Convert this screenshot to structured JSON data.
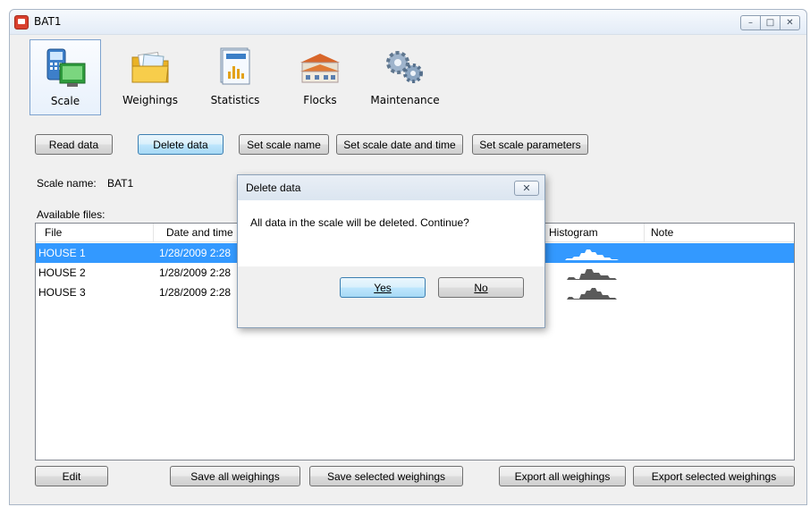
{
  "window": {
    "title": "BAT1"
  },
  "toolbar": {
    "items": [
      {
        "label": "Scale",
        "icon": "scale-icon",
        "selected": true
      },
      {
        "label": "Weighings",
        "icon": "folder-icon",
        "selected": false
      },
      {
        "label": "Statistics",
        "icon": "statistics-icon",
        "selected": false
      },
      {
        "label": "Flocks",
        "icon": "flocks-icon",
        "selected": false
      },
      {
        "label": "Maintenance",
        "icon": "gears-icon",
        "selected": false
      }
    ]
  },
  "actions": {
    "read": "Read data",
    "delete": "Delete data",
    "set_name": "Set scale name",
    "set_datetime": "Set scale date and time",
    "set_params": "Set scale parameters"
  },
  "scale_name_label": "Scale name:",
  "scale_name_value": "BAT1",
  "available_files_label": "Available files:",
  "files": {
    "columns": [
      "File",
      "Date and time",
      "Histogram",
      "Note"
    ],
    "rows": [
      {
        "file": "HOUSE 1",
        "datetime": "1/28/2009 2:28",
        "selected": true
      },
      {
        "file": "HOUSE 2",
        "datetime": "1/28/2009 2:28",
        "selected": false
      },
      {
        "file": "HOUSE 3",
        "datetime": "1/28/2009 2:28",
        "selected": false
      }
    ]
  },
  "bottom_buttons": {
    "edit": "Edit",
    "save_all": "Save all weighings",
    "save_selected": "Save selected weighings",
    "export_all": "Export all weighings",
    "export_selected": "Export selected weighings"
  },
  "dialog": {
    "title": "Delete data",
    "message": "All data in the scale will be deleted. Continue?",
    "yes": "Yes",
    "no": "No"
  },
  "colors": {
    "selection": "#3399ff",
    "histogram": "#5a5a5a"
  }
}
